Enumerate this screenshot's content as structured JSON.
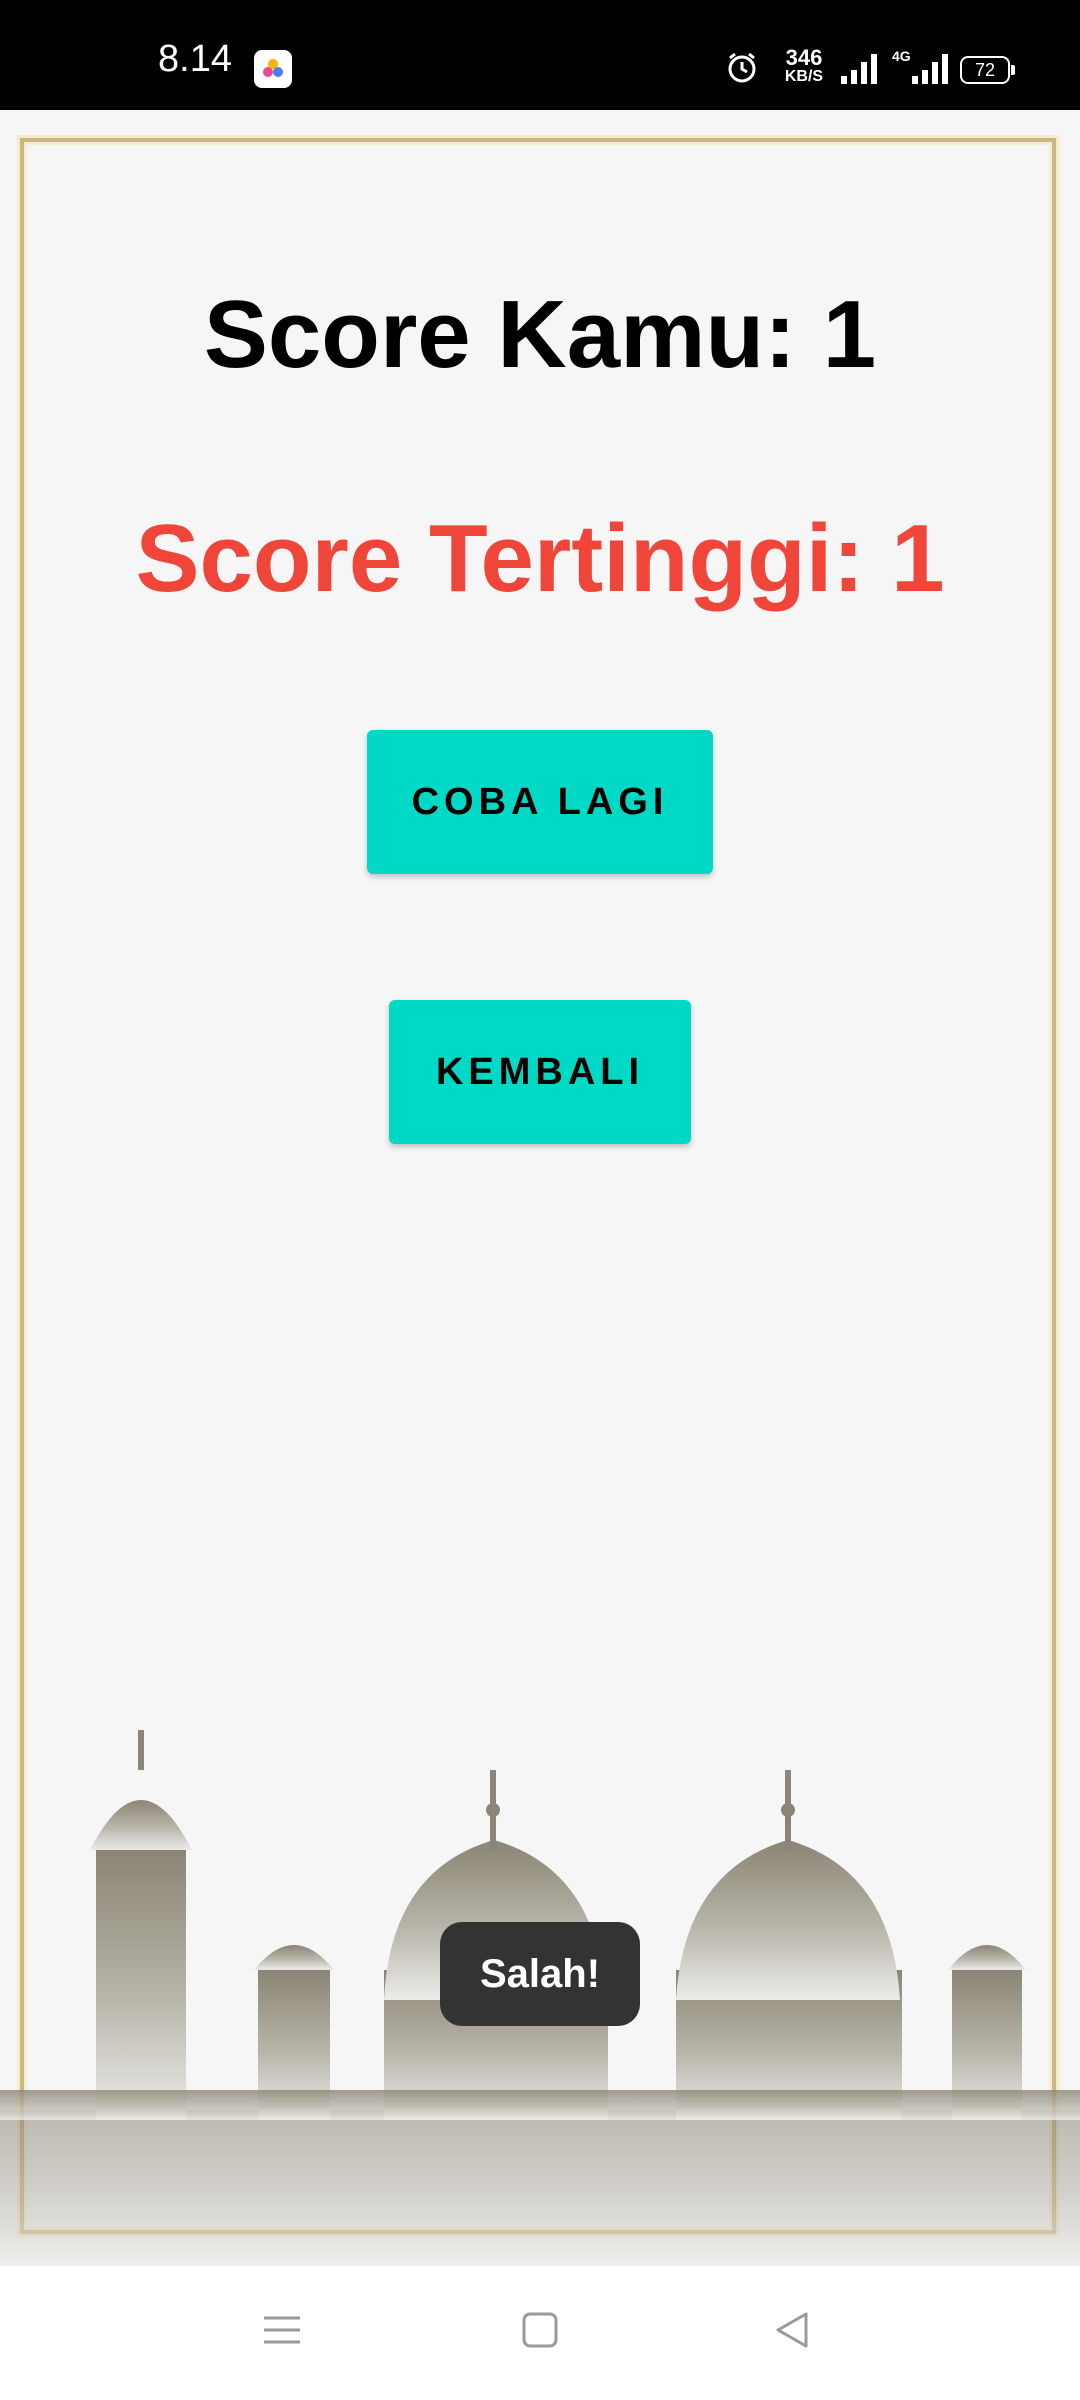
{
  "status_bar": {
    "time": "8.14",
    "speed_value": "346",
    "speed_unit": "KB/S",
    "network": "4G",
    "battery": "72",
    "icons": [
      "app-icon",
      "alarm-icon",
      "signal-icon",
      "signal-4g-icon",
      "battery-icon"
    ]
  },
  "result": {
    "score_label": "Score Kamu: 1",
    "best_score_label": "Score Tertinggi: 1",
    "best_color": "#f0463a"
  },
  "buttons": {
    "retry_label": "COBA LAGI",
    "back_label": "KEMBALI",
    "accent": "#00d9c5"
  },
  "toast": {
    "message": "Salah!"
  },
  "nav_bar": {
    "icons": [
      "menu-icon",
      "home-square-icon",
      "back-triangle-icon"
    ]
  }
}
